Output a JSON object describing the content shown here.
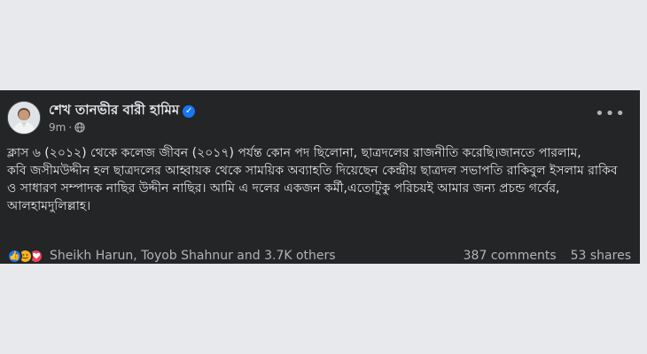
{
  "post": {
    "author": "শেখ তানভীর বারী হামিম",
    "verified_icon": "verified-badge-icon",
    "time": "9m",
    "separator": "·",
    "audience_icon": "globe-icon",
    "more_options_icon": "more-horizontal-icon",
    "more_options_label": "•••",
    "body_lines": [
      "ক্লাস ৬ (২০১২) থেকে কলেজ জীবন (২০১৭) পর্যন্ত কোন পদ ছিলোনা, ছাত্রদলের রাজনীতি করেছি।জানতে পারলাম,",
      "কবি জসীমউদ্দীন হল ছাত্রদলের আহ্বায়ক থেকে সাময়িক অব্যাহতি দিয়েছেন কেন্দ্রীয় ছাত্রদল সভাপতি রাকিবুল ইসলাম রাকিব ও সাধারণ সম্পাদক নাছির উদ্দীন নাছির। আমি এ দলের একজন কর্মী,এতোটুকু পরিচয়ই আমার জন্য প্রচন্ড গর্বের, আলহামদুলিল্লাহ।"
    ]
  },
  "reactions": {
    "icons": [
      "like-icon",
      "care-icon",
      "love-icon"
    ],
    "names": "Sheikh Harun, Toyob Shahnur and 3.7K others",
    "comments": "387 comments",
    "shares": "53 shares"
  },
  "colors": {
    "page_background": "#e7e9ed",
    "card_background": "#242526",
    "primary_text": "#e4e6eb",
    "secondary_text": "#b0b3b8",
    "like_blue": "#1877f2",
    "care_yellow": "#f7b125",
    "love_red": "#f33e58"
  }
}
